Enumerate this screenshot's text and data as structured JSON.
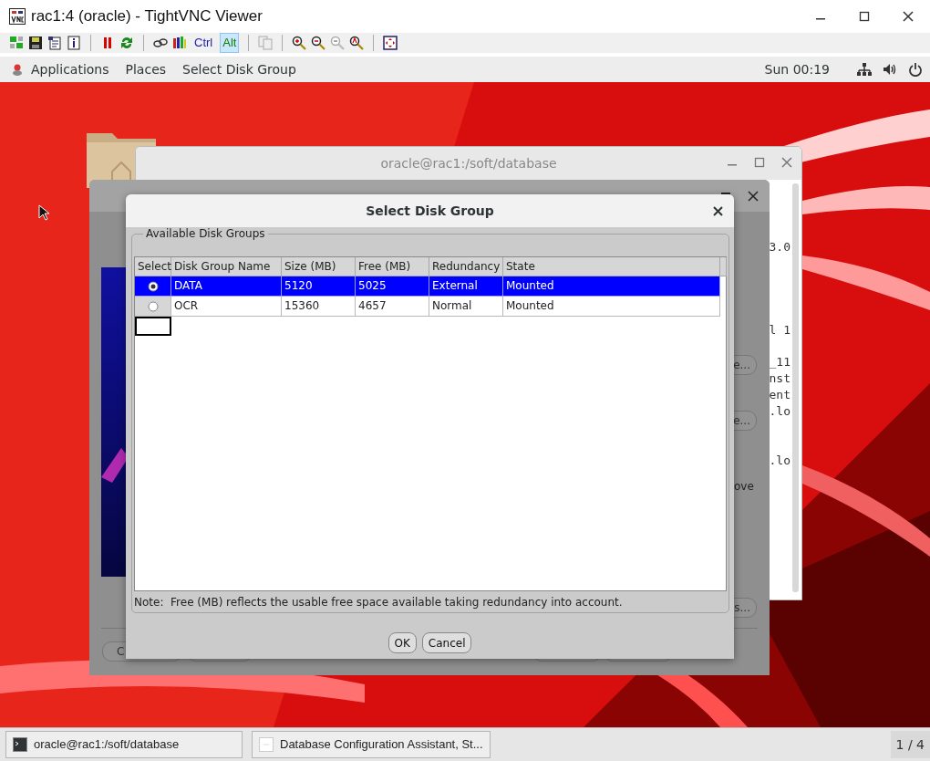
{
  "vnc_window": {
    "title": "rac1:4 (oracle) - TightVNC Viewer"
  },
  "toolbar": {
    "keys": [
      {
        "label": "Ctrl",
        "pressed": false,
        "color": "#1c1ca8"
      },
      {
        "label": "Alt",
        "pressed": true,
        "color": "#0b7d0b"
      }
    ]
  },
  "top_bar": {
    "menus": [
      "Applications",
      "Places",
      "Select Disk Group"
    ],
    "clock": "Sun 00:19"
  },
  "terminal": {
    "title": "oracle@rac1:/soft/database",
    "line_groups": [
      [
        "3.0"
      ],
      [
        "l 1"
      ],
      [
        "_11",
        "nst",
        "ent",
        ".lo"
      ],
      [
        ".lo"
      ]
    ]
  },
  "dbca_window": {
    "side_buttons": [
      "e...",
      "e...",
      "s..."
    ],
    "side_text": "ove",
    "bottom_buttons": [
      "C"
    ]
  },
  "dialog": {
    "title": "Select Disk Group",
    "group_label": "Available Disk Groups",
    "table": {
      "select_header": "Select",
      "columns": [
        "Disk Group Name",
        "Size (MB)",
        "Free (MB)",
        "Redundancy",
        "State"
      ],
      "rows": [
        {
          "selected": true,
          "cells": [
            "DATA",
            "5120",
            "5025",
            "External",
            "Mounted"
          ]
        },
        {
          "selected": false,
          "cells": [
            "OCR",
            "15360",
            "4657",
            "Normal",
            "Mounted"
          ]
        }
      ]
    },
    "note": "Note:  Free (MB) reflects the usable free space available taking redundancy into account.",
    "buttons": [
      "OK",
      "Cancel"
    ]
  },
  "taskbar": {
    "tasks": [
      {
        "kind": "terminal",
        "label": "oracle@rac1:/soft/database"
      },
      {
        "kind": "window",
        "label": "Database Configuration Assistant, St..."
      }
    ],
    "workspace": "1 / 4"
  }
}
